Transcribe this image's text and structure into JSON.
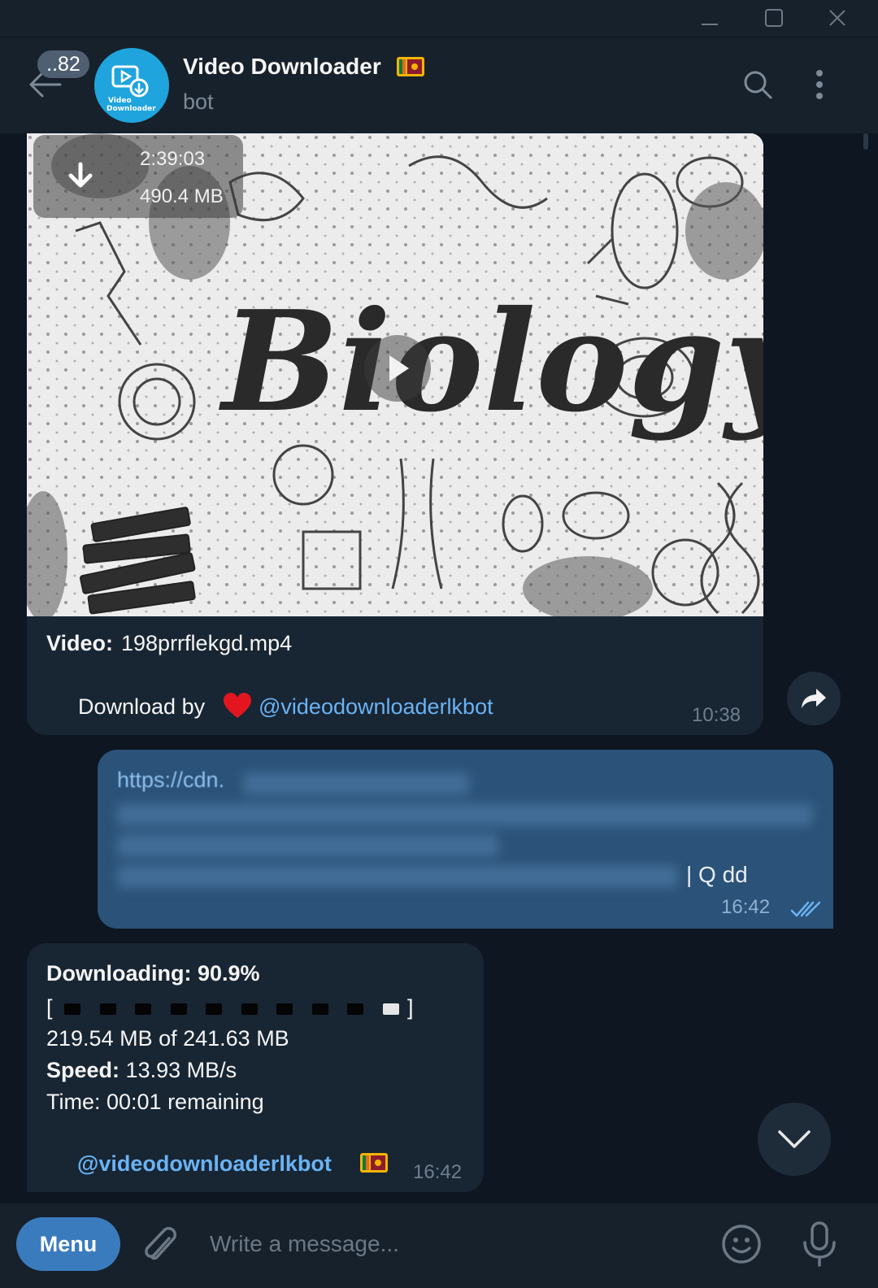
{
  "window": {
    "controls": [
      "minimize-icon",
      "maximize-icon",
      "close-icon"
    ]
  },
  "header": {
    "unread_count": "..82",
    "title": "Video Downloader",
    "subtitle": "bot",
    "avatar_icon": "video-download-logo-icon",
    "flag_icon": "sri-lanka-flag-icon"
  },
  "messages": {
    "video": {
      "duration": "2:39:03",
      "size": "490.4 MB",
      "thumbnail_text": "Biology",
      "caption_label": "Video:",
      "caption_file": "198prrflekgd.mp4",
      "download_by": "Download by",
      "bot_link": "@videodownloaderlkbot",
      "time": "10:38"
    },
    "outgoing": {
      "link_prefix": "https://cdn.",
      "tail": "| Q dd",
      "time": "16:42",
      "status": "read"
    },
    "downloading": {
      "status_label": "Downloading:",
      "percent": "90.9%",
      "progress": 0.909,
      "bracket_open": "[",
      "bracket_close": "]",
      "bytes": "219.54 MB of 241.63 MB",
      "speed_label": "Speed:",
      "speed": "13.93 MB/s",
      "time_text": "Time: 00:01 remaining",
      "bot_link": "@videodownloaderlkbot",
      "time": "16:42"
    }
  },
  "input": {
    "menu_label": "Menu",
    "placeholder": "Write a message..."
  },
  "colors": {
    "background": "#0e1621",
    "panel": "#17212b",
    "incoming_bubble": "#182533",
    "outgoing_bubble": "#2b5278",
    "link": "#6ab3f3",
    "accent": "#3a7bbd"
  }
}
